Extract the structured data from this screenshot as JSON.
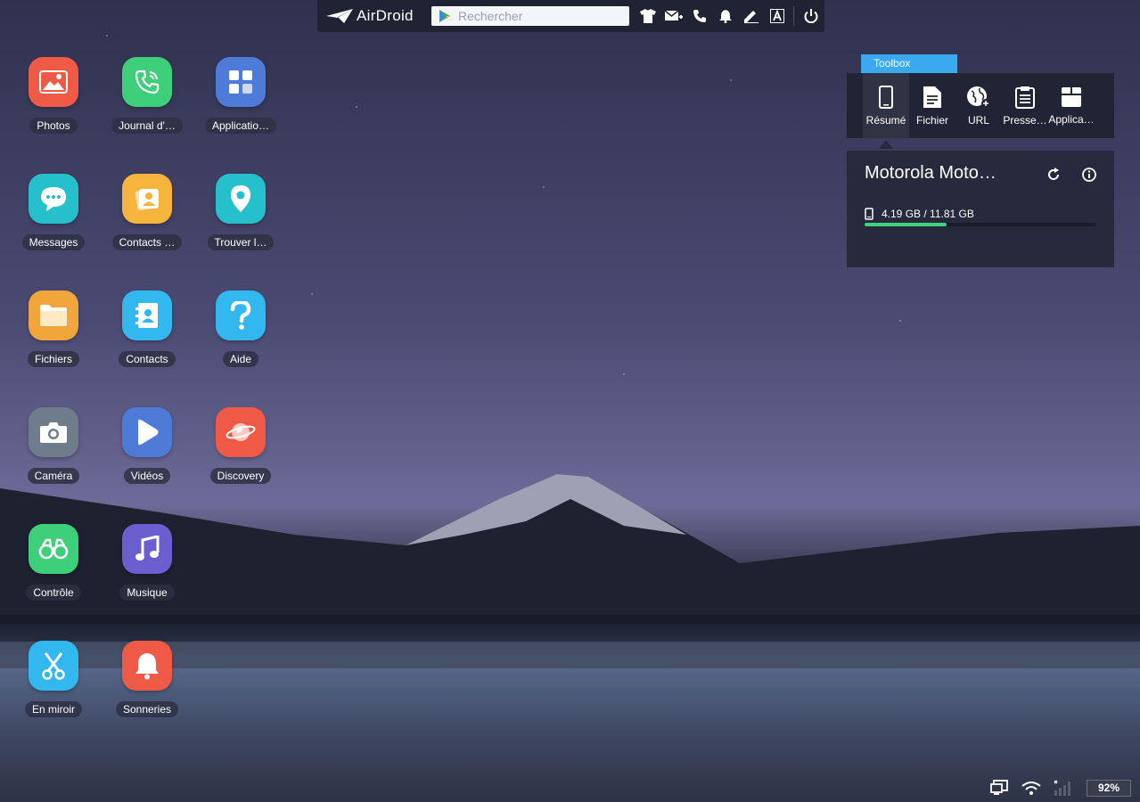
{
  "topbar": {
    "brand": "AirDroid",
    "search_placeholder": "Rechercher"
  },
  "apps": [
    {
      "label": "Photos",
      "color": "#ee5a46",
      "icon": "photo-icon"
    },
    {
      "label": "Journal d'…",
      "color": "#3ecf7b",
      "icon": "phone-icon"
    },
    {
      "label": "Applicatio…",
      "color": "#4f7bd8",
      "icon": "grid-icon"
    },
    {
      "label": "Messages",
      "color": "#26c0cc",
      "icon": "chat-icon"
    },
    {
      "label": "Contacts …",
      "color": "#f5b43b",
      "icon": "contact-card-icon"
    },
    {
      "label": "Trouver l…",
      "color": "#26c0cc",
      "icon": "location-pin-icon"
    },
    {
      "label": "Fichiers",
      "color": "#f0a63a",
      "icon": "folder-icon"
    },
    {
      "label": "Contacts",
      "color": "#32b7ef",
      "icon": "address-book-icon"
    },
    {
      "label": "Aide",
      "color": "#32b7ef",
      "icon": "help-icon"
    },
    {
      "label": "Caméra",
      "color": "#6e7c8c",
      "icon": "camera-icon"
    },
    {
      "label": "Vidéos",
      "color": "#4f7bd8",
      "icon": "play-icon"
    },
    {
      "label": "Discovery",
      "color": "#ee5a46",
      "icon": "planet-icon"
    },
    {
      "label": "Contrôle",
      "color": "#3ecf7b",
      "icon": "binoculars-icon"
    },
    {
      "label": "Musique",
      "color": "#6b5fd0",
      "icon": "music-icon"
    },
    {
      "label": "En miroir",
      "color": "#32b7ef",
      "icon": "scissors-icon"
    },
    {
      "label": "Sonneries",
      "color": "#ee5a46",
      "icon": "bell-icon"
    }
  ],
  "toolbox": {
    "tab": "Toolbox",
    "tools": [
      {
        "label": "Résumé",
        "icon": "device-icon",
        "active": true
      },
      {
        "label": "Fichier",
        "icon": "file-icon"
      },
      {
        "label": "URL",
        "icon": "globe-icon"
      },
      {
        "label": "Presse…",
        "icon": "clipboard-icon"
      },
      {
        "label": "Applica…",
        "icon": "package-icon"
      }
    ]
  },
  "device": {
    "name": "Motorola Moto…",
    "storage_text": "4.19 GB / 11.81 GB",
    "storage_used_fraction": 0.355
  },
  "statusbar": {
    "battery": "92%"
  },
  "colors": {
    "accent": "#3ba9f0",
    "progress": "#3fd27a"
  }
}
